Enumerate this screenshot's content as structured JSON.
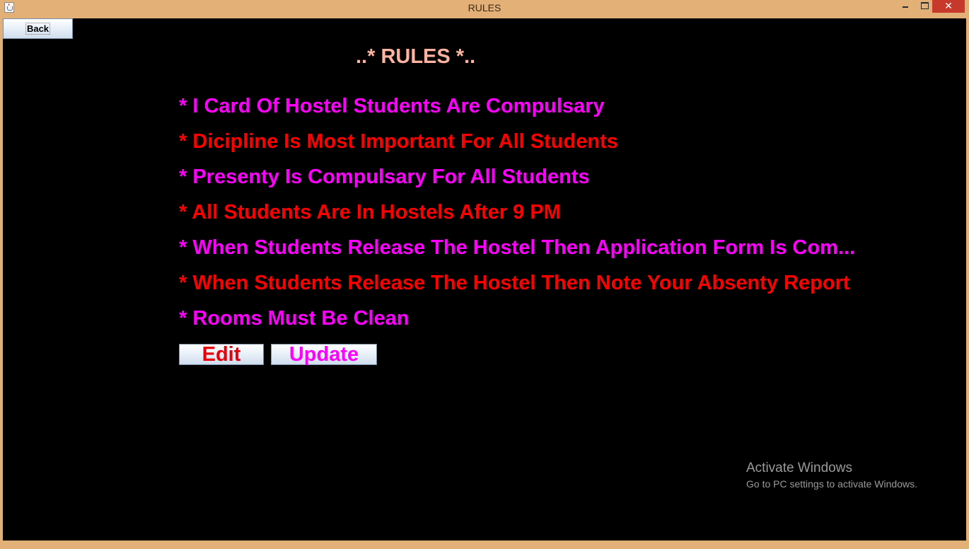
{
  "window": {
    "title": "RULES",
    "close_glyph": "✕",
    "icons": [
      "java-app-icon",
      "minimize-icon",
      "maximize-icon",
      "close-icon"
    ]
  },
  "toolbar": {
    "back_label": "Back"
  },
  "heading": "..* RULES *..",
  "rules": [
    {
      "text": "* I Card Of Hostel Students Are Compulsary",
      "color": "#ff00ff"
    },
    {
      "text": "* Dicipline Is Most Important For All Students",
      "color": "#ff0000"
    },
    {
      "text": "* Presenty Is Compulsary For All Students",
      "color": "#ff00ff"
    },
    {
      "text": "* All Students Are In Hostels After 9 PM",
      "color": "#ff0000"
    },
    {
      "text": "* When Students Release The Hostel Then Application Form Is Com...",
      "color": "#ff00ff"
    },
    {
      "text": "* When Students Release The Hostel Then Note Your Absenty Report",
      "color": "#ff0000"
    },
    {
      "text": "* Rooms Must Be Clean",
      "color": "#ff00ff"
    }
  ],
  "actions": {
    "edit_label": "Edit",
    "update_label": "Update"
  },
  "watermark": {
    "title": "Activate Windows",
    "subtitle": "Go to PC settings to activate Windows."
  },
  "colors": {
    "titlebar": "#e3b078",
    "background": "#000000",
    "heading": "#ffb3a0",
    "accent_magenta": "#ff00ff",
    "accent_red": "#ff0000",
    "close_button": "#c7392b"
  }
}
